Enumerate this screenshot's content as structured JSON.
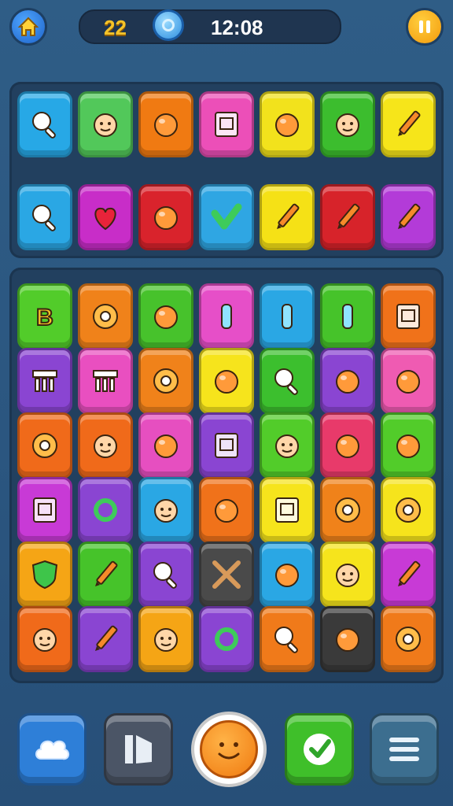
{
  "hud": {
    "level": "22",
    "time": "12:08"
  },
  "top_tray": {
    "rows": [
      [
        {
          "icon": "magnifier-icon",
          "color": "#27a8e6"
        },
        {
          "icon": "cowboy-character-icon",
          "color": "#52c85a"
        },
        {
          "icon": "orange-fruit-icon",
          "color": "#f07a12"
        },
        {
          "icon": "book-icon",
          "color": "#ec4fb8"
        },
        {
          "icon": "snail-swirl-icon",
          "color": "#f2e21c"
        },
        {
          "icon": "cat-face-icon",
          "color": "#3cbd2e"
        },
        {
          "icon": "pencil-icon",
          "color": "#f6e51a"
        }
      ],
      [
        {
          "icon": "magnifier-icon",
          "color": "#2aa7e4"
        },
        {
          "icon": "heart-icon",
          "color": "#c82dc8"
        },
        {
          "icon": "flowers-icon",
          "color": "#d9232c"
        },
        {
          "icon": "checkmark-icon",
          "color": "#2fa6e3"
        },
        {
          "icon": "crayon-icon",
          "color": "#f5e116"
        },
        {
          "icon": "pen-icon",
          "color": "#d7232a"
        },
        {
          "icon": "wand-icon",
          "color": "#b33bd8"
        }
      ]
    ]
  },
  "board": {
    "rows": [
      [
        {
          "icon": "letter-b-icon",
          "color": "#52cc2a"
        },
        {
          "icon": "gear-icon",
          "color": "#f0821a"
        },
        {
          "icon": "lemon-icon",
          "color": "#47c22c"
        },
        {
          "icon": "rocket-icon",
          "color": "#e64fc8"
        },
        {
          "icon": "cactus-icon",
          "color": "#2aa7e4"
        },
        {
          "icon": "bottle-icon",
          "color": "#46c32a"
        },
        {
          "icon": "frame-icon",
          "color": "#f0721a"
        }
      ],
      [
        {
          "icon": "temple-icon",
          "color": "#8a45d2"
        },
        {
          "icon": "chart-bars-icon",
          "color": "#e94fc0"
        },
        {
          "icon": "sawblade-icon",
          "color": "#f0821a"
        },
        {
          "icon": "melon-icon",
          "color": "#f6e41c"
        },
        {
          "icon": "magnifier-icon",
          "color": "#3cbf2e"
        },
        {
          "icon": "apple-icon",
          "color": "#8a45d2"
        },
        {
          "icon": "berry-icon",
          "color": "#ef5bb2"
        }
      ],
      [
        {
          "icon": "virus-icon",
          "color": "#f06a1a"
        },
        {
          "icon": "boy-face-icon",
          "color": "#f06a1a"
        },
        {
          "icon": "pizza-icon",
          "color": "#e64fc0"
        },
        {
          "icon": "square-button-icon",
          "color": "#8a45d2"
        },
        {
          "icon": "doll-icon",
          "color": "#52cc2a"
        },
        {
          "icon": "balloon-icon",
          "color": "#e83a6a"
        },
        {
          "icon": "bird-icon",
          "color": "#52cc2a"
        }
      ],
      [
        {
          "icon": "safe-icon",
          "color": "#c83ad6"
        },
        {
          "icon": "hook-icon",
          "color": "#8a45d2"
        },
        {
          "icon": "cloud-face-icon",
          "color": "#2aa7e4"
        },
        {
          "icon": "lollipop-icon",
          "color": "#f0721a"
        },
        {
          "icon": "envelope-icon",
          "color": "#f6e41c"
        },
        {
          "icon": "sun-icon",
          "color": "#f0821a"
        },
        {
          "icon": "cookie-icon",
          "color": "#f6e41c"
        }
      ],
      [
        {
          "icon": "shield-icon",
          "color": "#f5a515"
        },
        {
          "icon": "torch-icon",
          "color": "#46c32a"
        },
        {
          "icon": "magnifier-icon",
          "color": "#8a45d2"
        },
        {
          "icon": "crossed-bones-icon",
          "color": "#4a4a4a"
        },
        {
          "icon": "octopus-icon",
          "color": "#2aa7e4"
        },
        {
          "icon": "baby-icon",
          "color": "#f6e41c"
        },
        {
          "icon": "marker-icon",
          "color": "#c83ad6"
        }
      ],
      [
        {
          "icon": "pirate-face-icon",
          "color": "#f06a1a"
        },
        {
          "icon": "pencil-icon",
          "color": "#8a45d2"
        },
        {
          "icon": "sun-face-icon",
          "color": "#f5a515"
        },
        {
          "icon": "ring-icon",
          "color": "#8a45d2"
        },
        {
          "icon": "magnifier-icon",
          "color": "#f07a1a"
        },
        {
          "icon": "ghost-icon",
          "color": "#3a3a3a"
        },
        {
          "icon": "spiral-icon",
          "color": "#f07a1a"
        }
      ]
    ]
  },
  "controls": {
    "hint": "cloud-hint-icon",
    "shuffle": "shuffle-icon",
    "center": "smiley-icon",
    "undo": "check-icon",
    "menu": "hamburger-icon"
  }
}
